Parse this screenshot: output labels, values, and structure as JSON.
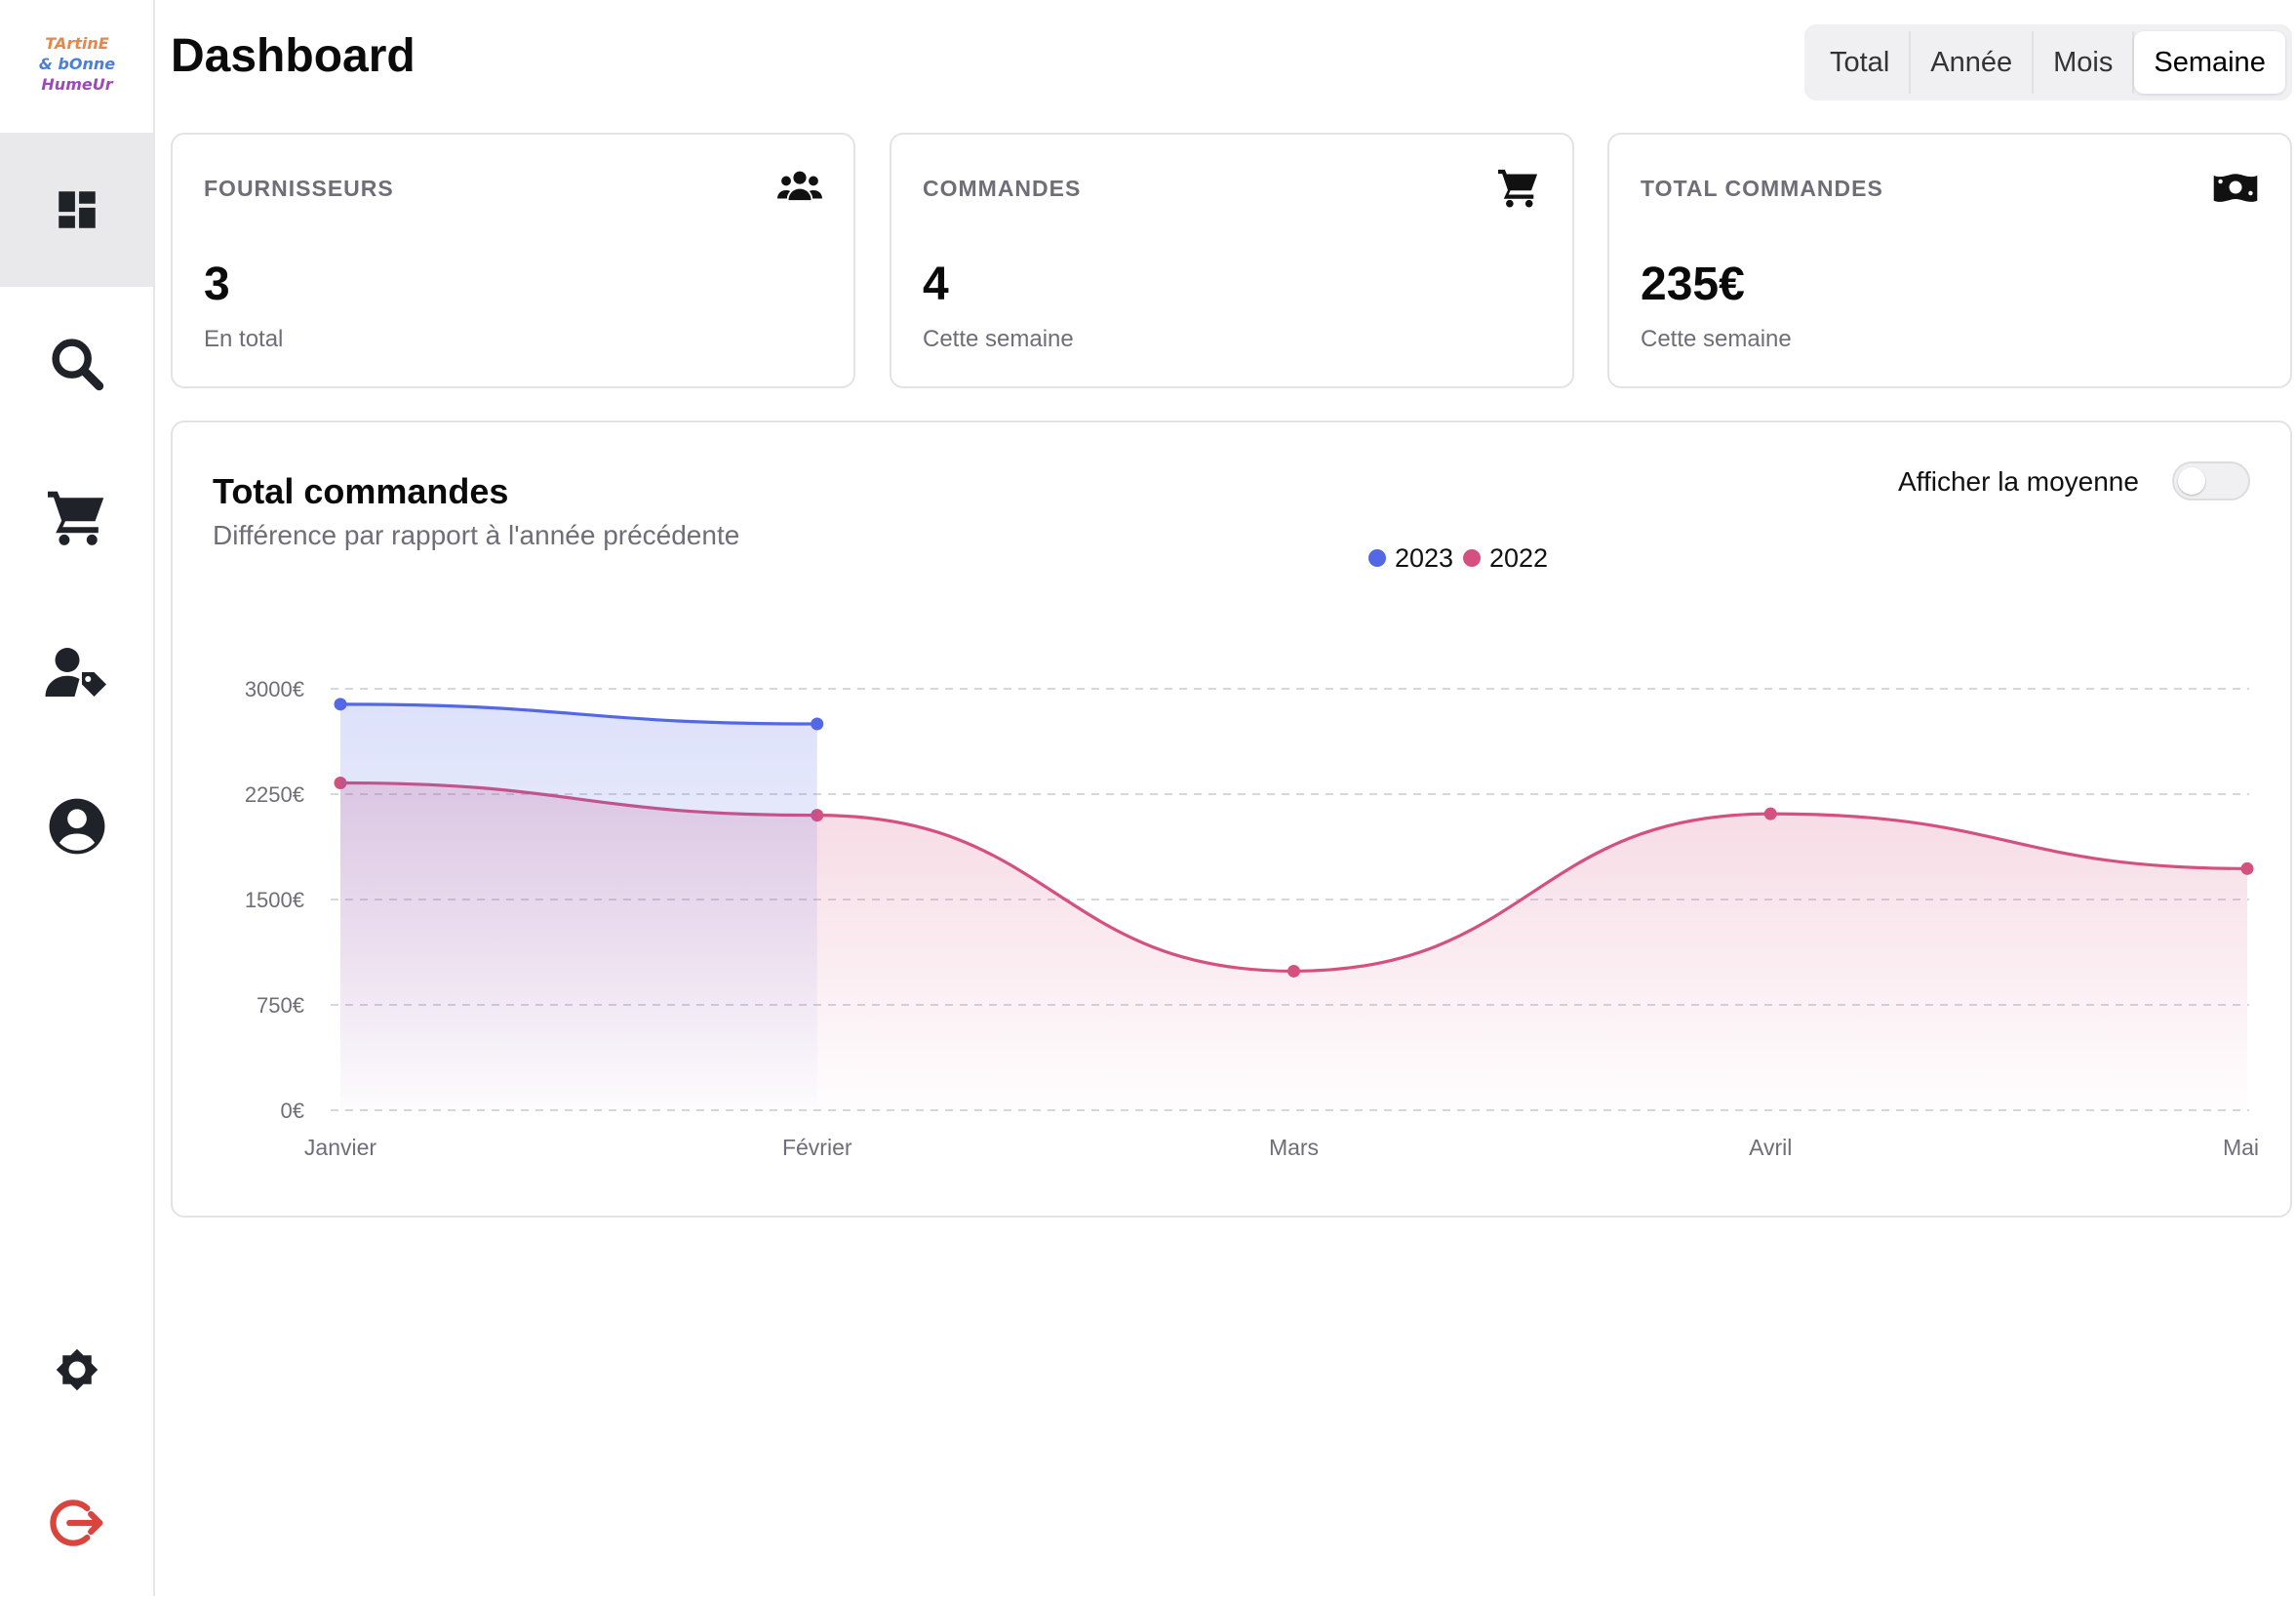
{
  "app": {
    "logo_lines": [
      "TArtinE",
      "& bOnne",
      "HumeUr"
    ]
  },
  "sidebar": {
    "items": [
      {
        "icon": "dashboard-icon",
        "active": true
      },
      {
        "icon": "search-icon",
        "active": false
      },
      {
        "icon": "cart-icon",
        "active": false
      },
      {
        "icon": "supplier-tag-icon",
        "active": false
      },
      {
        "icon": "account-circle-icon",
        "active": false
      }
    ],
    "bottom_items": [
      {
        "icon": "gear-icon"
      },
      {
        "icon": "logout-icon",
        "color": "#d9453d"
      }
    ]
  },
  "header": {
    "title": "Dashboard",
    "periods": [
      "Total",
      "Année",
      "Mois",
      "Semaine"
    ],
    "active_period": "Semaine"
  },
  "stats": [
    {
      "label": "FOURNISSEURS",
      "value": "3",
      "sub": "En total",
      "icon": "users-icon"
    },
    {
      "label": "COMMANDES",
      "value": "4",
      "sub": "Cette semaine",
      "icon": "cart-icon"
    },
    {
      "label": "TOTAL COMMANDES",
      "value": "235€",
      "sub": "Cette semaine",
      "icon": "money-bill-icon"
    }
  ],
  "chart_panel": {
    "title": "Total commandes",
    "subtitle": "Différence par rapport à l'année précédente",
    "toggle_label": "Afficher la moyenne",
    "toggle_on": false
  },
  "chart_data": {
    "type": "area",
    "categories": [
      "Janvier",
      "Février",
      "Mars",
      "Avril",
      "Mai"
    ],
    "ylim": [
      0,
      3000
    ],
    "yticks": [
      0,
      750,
      1500,
      2250,
      3000
    ],
    "ytick_labels": [
      "0€",
      "750€",
      "1500€",
      "2250€",
      "3000€"
    ],
    "grid": true,
    "legend_position": "top-right",
    "series": [
      {
        "name": "2023",
        "color": "#5468e6",
        "values": [
          2890,
          2750,
          null,
          null,
          null
        ]
      },
      {
        "name": "2022",
        "color": "#d4507e",
        "values": [
          2330,
          2100,
          990,
          2110,
          1720
        ]
      }
    ]
  }
}
